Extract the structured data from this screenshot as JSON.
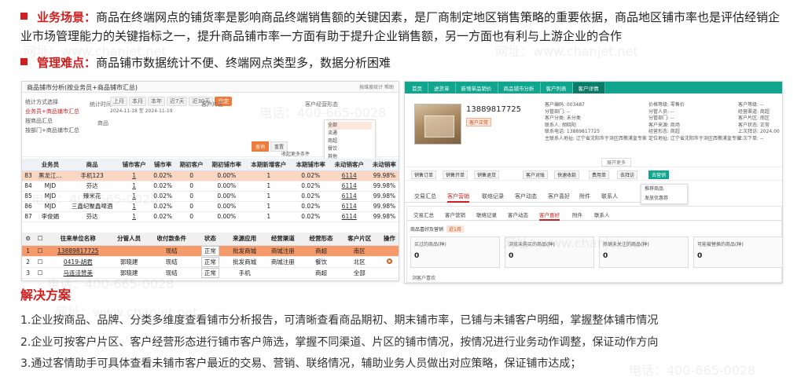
{
  "intro": {
    "biz_label": "业务场景：",
    "biz_text": "商品在终端网点的铺货率是影响商品终端销售额的关键因素，是厂商制定地区销售策略的重要依据，商品地区铺市率也是评估经销企业市场管理能力的关键指标之一，提升商品铺市率一方面有助于提升企业销售额，另一方面也有利与上游企业的合作",
    "pain_label": "管理难点：",
    "pain_text": "商品铺市数据统计不便、终端网点类型多，数据分析困难"
  },
  "left_panel": {
    "title": "商品铺市分析(按业务员+商品铺市汇总)",
    "title_right": "按维度统计 帮助",
    "sidebar": {
      "header": "统计方式选择",
      "items": [
        "业务员+商品铺市汇总",
        "按商品汇总",
        "按部门+商品铺市汇总"
      ]
    },
    "filters": {
      "date_label": "统计时间",
      "date_chips": [
        "上月",
        "本月",
        "本年",
        "近7天",
        "近30天",
        "自定"
      ],
      "date_range": "2024-11-18 至 2024-11-19",
      "area_label": "客户片区",
      "form_label": "客户经营形态",
      "goods_label": "商品",
      "dropdown_items": [
        "全部",
        "流通",
        "商超",
        "餐饮",
        "其他"
      ],
      "query_btn": "查询",
      "reset_btn": "重置",
      "more_btn": "收起更多条件"
    },
    "table1": {
      "headers": [
        "",
        "业务员",
        "商品",
        "铺市客户",
        "铺市率",
        "期初客户",
        "期初铺市率",
        "本期新增客户",
        "本期铺市率",
        "未动销客户",
        "未动销率"
      ],
      "rows": [
        [
          "83",
          "黑龙江...",
          "手机123",
          "1",
          "0.02%",
          "0",
          "0.00%",
          "1",
          "0.02%",
          "6114",
          "99.98%"
        ],
        [
          "84",
          "MJD",
          "芬达",
          "1",
          "0.02%",
          "0",
          "0.00%",
          "1",
          "0.02%",
          "6114",
          "99.98%"
        ],
        [
          "85",
          "MJD",
          "臻米花",
          "1",
          "0.02%",
          "0",
          "0.00%",
          "1",
          "0.02%",
          "6114",
          "99.98%"
        ],
        [
          "86",
          "MJD",
          "三鑫纪聚鑫啤酒",
          "1",
          "0.02%",
          "0",
          "0.00%",
          "1",
          "0.02%",
          "6114",
          "99.98%"
        ],
        [
          "87",
          "李俊娟",
          "芬达",
          "1",
          "0.02%",
          "0",
          "0.00%",
          "1",
          "0.02%",
          "6114",
          "99.98%"
        ]
      ]
    },
    "table2": {
      "headers": [
        "",
        "",
        "往来单位名称",
        "分管人员",
        "收付款条件",
        "状态",
        "来源应用",
        "经营渠道",
        "经营形态",
        "客户片区",
        "操作"
      ],
      "rows": [
        [
          "1",
          "",
          "13889817725",
          "",
          "现结",
          "正常",
          "批发商城",
          "商城注册",
          "商超",
          "南区",
          ""
        ],
        [
          "2",
          "",
          "0419-胡君",
          "郭晓建",
          "现结",
          "正常",
          "批发商城",
          "商城注册",
          "餐饮",
          "北区",
          ""
        ],
        [
          "3",
          "",
          "马连洼赞美",
          "郭晓建",
          "现结",
          "正常",
          "手机",
          "",
          "商超",
          "全部",
          ""
        ]
      ]
    }
  },
  "right_panel": {
    "nav": [
      "首页",
      "进货单",
      "新增单品销价",
      "商品铺市分析",
      "客户列表",
      "客户详情"
    ],
    "phone": "13889817725",
    "tag": "客户正常",
    "info_col1": [
      "客户编码: 003487",
      "分管部门: --",
      "客户分类: 未分类",
      "联系人: 胡晓阳",
      "联系电话: 13889817725",
      "主联系人地址: 辽宁省沈阳市于洪区西樵浦皇专家"
    ],
    "info_col2": [
      "价格等级: 零售价",
      "分管人员: --",
      "分管部门: --",
      "客户来源: 商场",
      "经营形态: 商超",
      "定位地址: 辽宁省沈阳市于洪区西樵浦皇专家"
    ],
    "info_col3": [
      "客户等级: --",
      "经营渠道: 商超",
      "客户片区: 南区",
      "客户状态: 正常",
      "上次拜访: 2024.00",
      "上次下单: --"
    ],
    "more": "展开更多",
    "actions": [
      "销售订单",
      "销售开单",
      "销售退货",
      "客户对账",
      "快速收款",
      "费用单",
      "去拜访",
      "去营销"
    ],
    "side_menu": [
      "推荐商品",
      "发放优惠券"
    ],
    "tabs1": [
      "交易汇总",
      "客户营销",
      "联络记录",
      "客户动态",
      "客户喜好",
      "附件",
      "联系人"
    ],
    "tabs2": [
      "交易汇总",
      "客户营销",
      "联络记录",
      "客户动态",
      "客户喜好",
      "附件",
      "联系人"
    ],
    "sub_label": "商品喜好及营销",
    "sub_badge": "近1月",
    "stats": [
      {
        "label": "买过的商品(种)",
        "value": "0"
      },
      {
        "label": "浏览未购买的商品(种)",
        "value": "0"
      },
      {
        "label": "热销未关注的商品(种)",
        "value": "0"
      },
      {
        "label": "可能被替换的商品(种)",
        "value": "0"
      }
    ],
    "footer_label": "浏客户喜欢"
  },
  "solution": {
    "title": "解决方案",
    "items": [
      "1.企业按商品、品牌、分类多维度查看铺市分析报告，可清晰查看商品期初、期末铺市率，已铺与未铺客户明细，掌握整体铺市情况",
      "2.企业可按客户片区、客户经营形态进行铺市客户筛选，掌握不同渠道、片区的铺市情况，按情况进行业务动作调整，保证动作方向",
      "3.通过客情助手可具体查看未铺市客户最近的交易、营销、联络情况，辅助业务人员做出对应策略，保证铺市达成；"
    ]
  },
  "watermark": {
    "phone": "电话：400-665-0028",
    "site": "网址：www.chanjet.net"
  },
  "colors": {
    "accent_red": "#d01f1f",
    "teal": "#0fa58e",
    "orange": "#f07b3a"
  }
}
